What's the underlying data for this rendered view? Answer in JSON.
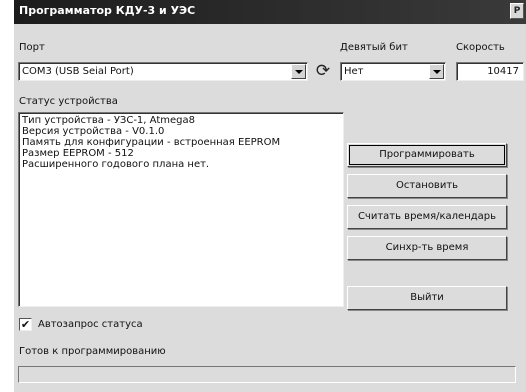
{
  "window": {
    "title": "Программатор КДУ-3 и УЭС",
    "title_button": "Р"
  },
  "port": {
    "label": "Порт",
    "value": "COM3 (USB Seial Port)"
  },
  "ninth_bit": {
    "label": "Девятый бит",
    "value": "Нет"
  },
  "speed": {
    "label": "Скорость",
    "value": "10417"
  },
  "status": {
    "label": "Статус устройства",
    "lines": [
      "Тип устройства - УЗС-1, Atmega8",
      "Версия устройства - V0.1.0",
      "Память для конфигурации - встроенная EEPROM",
      "Размер EEPROM - 512",
      "Расширенного годового плана нет."
    ]
  },
  "buttons": {
    "program": "Программировать",
    "stop": "Остановить",
    "read_time": "Считать время/календарь",
    "sync_time": "Синхр-ть время",
    "exit": "Выйти"
  },
  "auto_status": {
    "label": "Автозапрос статуса",
    "checked": true,
    "mark": "✔"
  },
  "status_bar": {
    "text": "Готов к программированию",
    "progress": 0
  },
  "icons": {
    "refresh": "refresh-icon"
  }
}
